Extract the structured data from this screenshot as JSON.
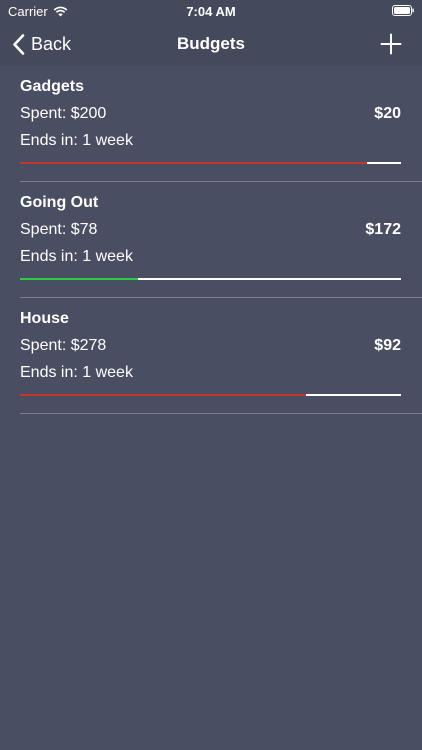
{
  "status_bar": {
    "carrier": "Carrier",
    "time": "7:04 AM",
    "wifi_icon": "wifi-icon",
    "battery_icon": "battery-icon"
  },
  "nav": {
    "back_label": "Back",
    "title": "Budgets",
    "back_icon": "chevron-left-icon",
    "add_icon": "plus-icon"
  },
  "colors": {
    "background": "#4a4e62",
    "bar": "#45495c",
    "over": "#c0392b",
    "under": "#2ecc40",
    "track": "#ffffff"
  },
  "budgets": [
    {
      "name": "Gadgets",
      "spent": "Spent: $200",
      "remaining": "$20",
      "ends": "Ends in: 1 week",
      "progress": 0.91,
      "status": "over"
    },
    {
      "name": "Going Out",
      "spent": "Spent: $78",
      "remaining": "$172",
      "ends": "Ends in: 1 week",
      "progress": 0.31,
      "status": "under"
    },
    {
      "name": "House",
      "spent": "Spent: $278",
      "remaining": "$92",
      "ends": "Ends in: 1 week",
      "progress": 0.75,
      "status": "over"
    }
  ]
}
